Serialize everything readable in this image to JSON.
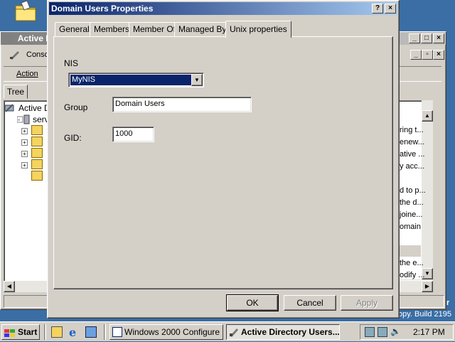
{
  "dialog": {
    "title": "Domain Users Properties",
    "help_btn": "?",
    "close_btn": "×",
    "tabs": [
      "General",
      "Members",
      "Member Of",
      "Managed By",
      "Unix properties"
    ],
    "active_tab": "Unix properties",
    "nis_label": "NIS",
    "nis_value": "MyNIS",
    "group_label": "Group",
    "group_value": "Domain Users",
    "gid_label": "GID:",
    "gid_value": "1000",
    "ok": "OK",
    "cancel": "Cancel",
    "apply": "Apply"
  },
  "background_window": {
    "title": "Active D",
    "console_menu": "Conso",
    "action_menu": "Action",
    "tree_tab": "Tree",
    "tree_root": "Active D",
    "tree_server": "serv",
    "right_texts": [
      "ring t...",
      "enew...",
      "ative ...",
      "y acc...",
      "d to p...",
      "the d...",
      "joine...",
      "omain",
      "the e...",
      "odify ..."
    ],
    "status_build": "opy. Build 2195",
    "partial_r": "r"
  },
  "taskbar": {
    "start": "Start",
    "buttons": [
      "Windows 2000 Configure ...",
      "Active Directory Users..."
    ],
    "active_button": "Active Directory Users...",
    "clock": "2:17 PM"
  },
  "colors": {
    "desktop": "#3a6ea5",
    "face": "#d4d0c8",
    "title_active": "#0a246a",
    "selection": "#0a246a"
  }
}
